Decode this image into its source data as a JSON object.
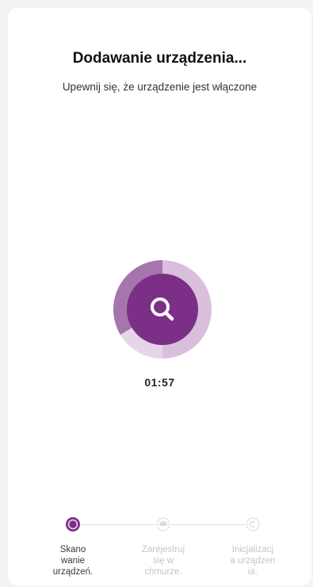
{
  "header": {
    "title": "Dodawanie urządzenia...",
    "subtitle": "Upewnij się, że urządzenie jest włączone"
  },
  "scanner": {
    "icon": "search-icon",
    "timer": "01:57",
    "accent_color": "#7b2f86",
    "ring_color": "#c9a3cf"
  },
  "steps": [
    {
      "label": "Skano\nwanie\nurządzeń.",
      "state": "active"
    },
    {
      "label": "Zarejestruj\nsię w\nchmurze.",
      "state": "pending"
    },
    {
      "label": "Inicjalizacj\na urządzen\nia.",
      "state": "pending"
    }
  ]
}
